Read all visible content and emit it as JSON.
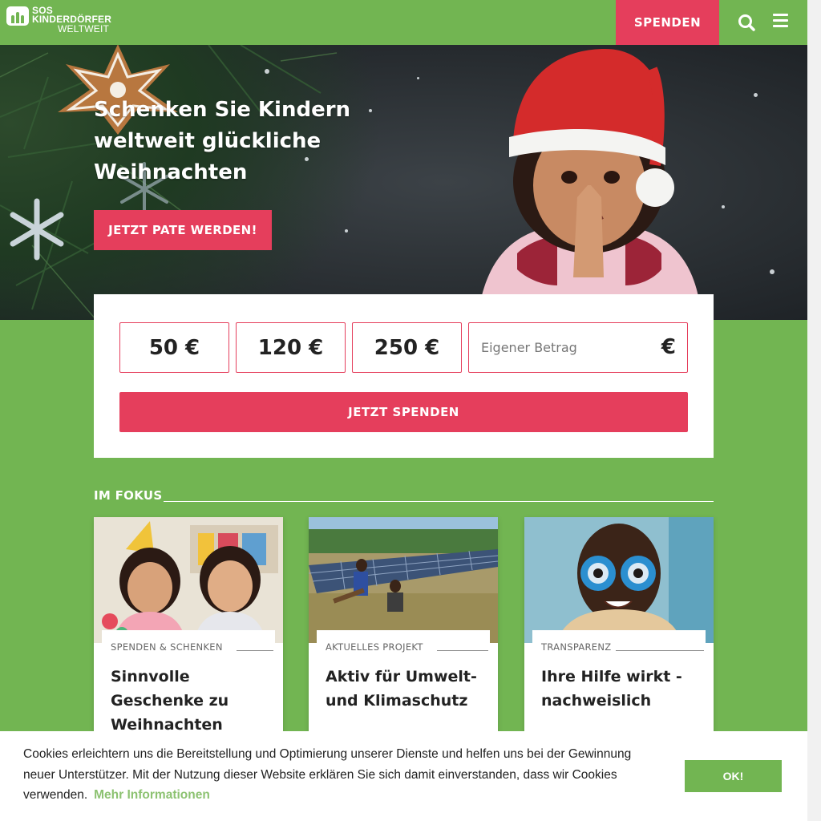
{
  "header": {
    "logo_line1": "SOS",
    "logo_line2": "KINDERDÖRFER",
    "logo_line3": "WELTWEIT",
    "donate_label": "SPENDEN",
    "search_icon": "search-icon",
    "menu_icon": "hamburger-menu-icon"
  },
  "hero": {
    "title": "Schenken Sie Kindern weltweit glückliche Weihnachten",
    "cta_label": "JETZT PATE WERDEN!"
  },
  "donation": {
    "amounts": [
      "50 €",
      "120 €",
      "250 €"
    ],
    "custom_placeholder": "Eigener Betrag",
    "currency_symbol": "€",
    "submit_label": "JETZT SPENDEN"
  },
  "fokus": {
    "heading": "IM FOKUS",
    "cards": [
      {
        "tag": "SPENDEN & SCHENKEN",
        "title": "Sinnvolle Geschenke zu Weihnachten"
      },
      {
        "tag": "AKTUELLES PROJEKT",
        "title": "Aktiv für Umwelt- und Klimaschutz"
      },
      {
        "tag": "TRANSPARENZ",
        "title": "Ihre Hilfe wirkt - nachweislich"
      }
    ]
  },
  "cookie": {
    "text": "Cookies erleichtern uns die Bereitstellung und Optimierung unserer Dienste und helfen uns bei der Gewinnung neuer Unterstützer. Mit der Nutzung dieser Website erklären Sie sich damit einverstanden, dass wir Cookies verwenden.",
    "link_label": "Mehr Informationen",
    "ok_label": "OK!"
  },
  "colors": {
    "brand_green": "#72b552",
    "accent_red": "#e53e5c",
    "link_green": "#8cc271"
  }
}
